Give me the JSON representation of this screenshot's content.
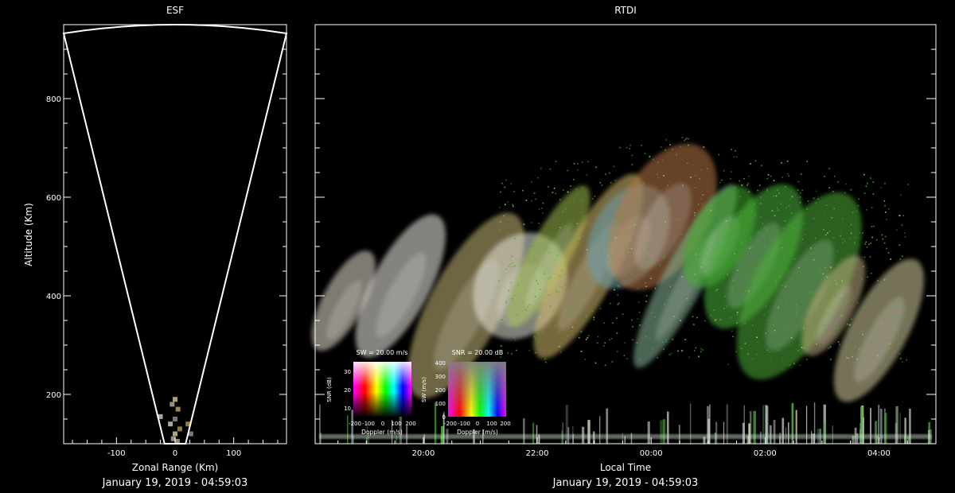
{
  "colors": {
    "background": "#000000",
    "foreground": "#ffffff",
    "echo_green": "#3fae2a"
  },
  "chart_data": [
    {
      "type": "scatter",
      "title": "ESF",
      "xlabel": "Zonal Range (Km)",
      "ylabel": "Altitude (Km)",
      "xlim": [
        -190,
        190
      ],
      "ylim": [
        100,
        950
      ],
      "x_ticks": [
        -100,
        0,
        100
      ],
      "y_ticks": [
        200,
        400,
        600,
        800
      ],
      "date_label": "January 19, 2019 - 04:59:03",
      "beam_fan": {
        "left_edge_x": [
          -18,
          -190
        ],
        "right_edge_x": [
          18,
          190
        ],
        "top_altitude": 950
      },
      "echoes": [
        {
          "x": 0,
          "y": 190
        },
        {
          "x": -5,
          "y": 180
        },
        {
          "x": 5,
          "y": 170
        },
        {
          "x": 0,
          "y": 150
        },
        {
          "x": -8,
          "y": 140
        },
        {
          "x": 8,
          "y": 130
        },
        {
          "x": 0,
          "y": 120
        },
        {
          "x": -3,
          "y": 110
        },
        {
          "x": 4,
          "y": 105
        },
        {
          "x": 27,
          "y": 120
        },
        {
          "x": -25,
          "y": 155
        },
        {
          "x": 22,
          "y": 140
        }
      ]
    },
    {
      "type": "heatmap",
      "title": "RTDI",
      "xlabel": "Local Time",
      "ylabel": "",
      "x_ticks": [
        "20:00",
        "22:00",
        "00:00",
        "02:00",
        "04:00"
      ],
      "xlim_hours": [
        18.1,
        29.0
      ],
      "ylim": [
        100,
        950
      ],
      "y_ticks": [
        200,
        400,
        600,
        800
      ],
      "date_label": "January 19, 2019 - 04:59:03",
      "plumes": [
        {
          "t": 18.6,
          "alt": 390,
          "color": "#e8e0d0"
        },
        {
          "t": 19.6,
          "alt": 420,
          "color": "#f0eee6"
        },
        {
          "t": 20.75,
          "alt": 380,
          "color": "#c8b878"
        },
        {
          "t": 21.7,
          "alt": 420,
          "color": "#e6e6dc"
        },
        {
          "t": 22.2,
          "alt": 480,
          "color": "#a0c050"
        },
        {
          "t": 22.9,
          "alt": 460,
          "color": "#d8c070"
        },
        {
          "t": 23.6,
          "alt": 520,
          "color": "#6ca0b0"
        },
        {
          "t": 0.2,
          "alt": 560,
          "color": "#b87848"
        },
        {
          "t": 0.6,
          "alt": 440,
          "color": "#8ab89a"
        },
        {
          "t": 1.2,
          "alt": 520,
          "color": "#3fae2a"
        },
        {
          "t": 1.8,
          "alt": 480,
          "color": "#50b840"
        },
        {
          "t": 2.6,
          "alt": 420,
          "color": "#4fb03a"
        },
        {
          "t": 3.2,
          "alt": 380,
          "color": "#c0b080"
        },
        {
          "t": 4.0,
          "alt": 330,
          "color": "#d8d0a0"
        }
      ],
      "legend_sw": {
        "title": "SW = 20.00 m/s",
        "x_label": "Doppler (m/s)",
        "y_label": "SNR (dB)",
        "x_ticks": [
          "-200",
          "-100",
          "0",
          "100",
          "200"
        ],
        "y_ticks": [
          "30",
          "20",
          "10"
        ]
      },
      "legend_snr": {
        "title": "SNR = 20.00 dB",
        "x_label": "Doppler (m/s)",
        "y_label": "SW (m/s)",
        "x_ticks": [
          "-200",
          "-100",
          "0",
          "100",
          "200"
        ],
        "y_ticks": [
          "400",
          "300",
          "200",
          "100",
          "0"
        ]
      }
    }
  ]
}
